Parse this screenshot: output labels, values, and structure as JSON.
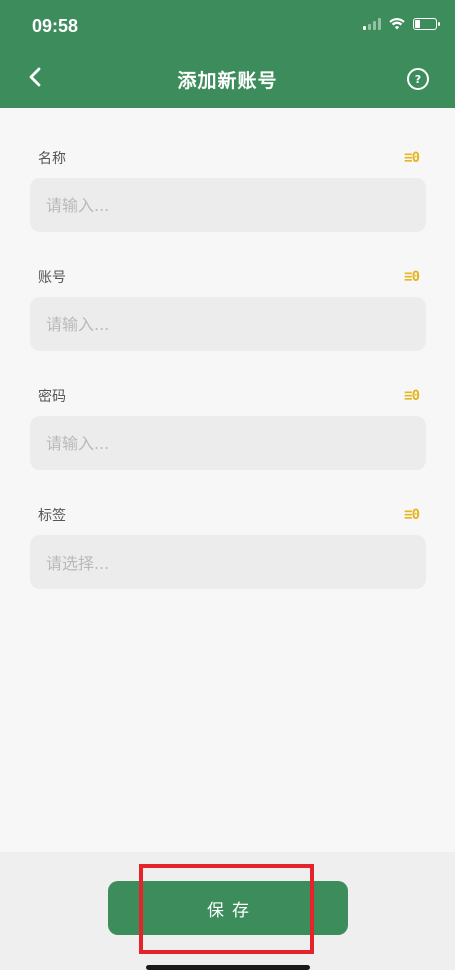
{
  "status_bar": {
    "time": "09:58",
    "icons": [
      "signal-icon",
      "wifi-icon",
      "battery-icon"
    ]
  },
  "header": {
    "title": "添加新账号",
    "back_icon": "chevron-left-icon",
    "help_icon": "question-circle-icon",
    "help_glyph": "?"
  },
  "form": {
    "fields": [
      {
        "label": "名称",
        "placeholder": "请输入...",
        "value": "",
        "icon": "list-icon",
        "icon_glyph": "≡0"
      },
      {
        "label": "账号",
        "placeholder": "请输入...",
        "value": "",
        "icon": "list-icon",
        "icon_glyph": "≡0"
      },
      {
        "label": "密码",
        "placeholder": "请输入...",
        "value": "",
        "icon": "list-icon",
        "icon_glyph": "≡0"
      },
      {
        "label": "标签",
        "placeholder": "请选择...",
        "value": "",
        "icon": "list-icon",
        "icon_glyph": "≡0"
      }
    ]
  },
  "footer": {
    "save_label": "保存"
  },
  "colors": {
    "primary": "#3d8c5c",
    "accent": "#e6b520",
    "highlight": "#e5232a",
    "background": "#f7f7f7",
    "input_bg": "#ececec"
  }
}
